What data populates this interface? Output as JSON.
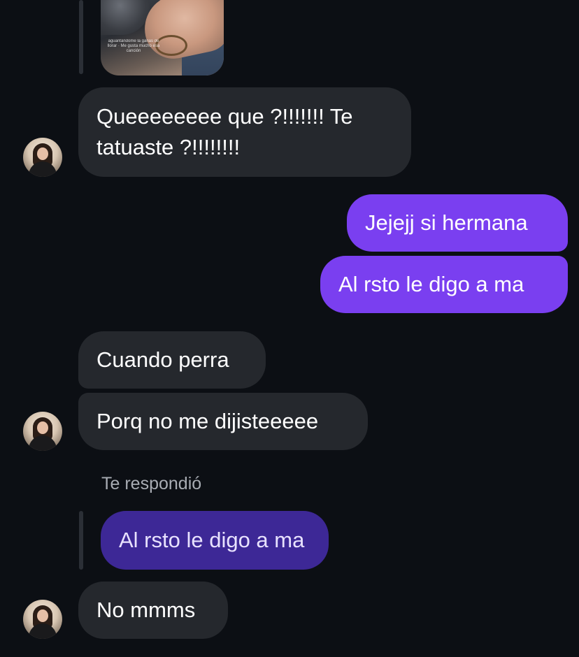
{
  "shared_story": {
    "caption": "aguantándome la ganas de llorar · Me gusta mucho esa canción"
  },
  "messages": [
    {
      "id": "m1",
      "direction": "incoming",
      "text": "Queeeeeeee que ?!!!!!!! Te tatuaste ?!!!!!!!!"
    },
    {
      "id": "m2",
      "direction": "outgoing",
      "text": "Jejejj si hermana"
    },
    {
      "id": "m3",
      "direction": "outgoing",
      "text": "Al rsto le digo a ma"
    },
    {
      "id": "m4",
      "direction": "incoming",
      "text": "Cuando perra"
    },
    {
      "id": "m5",
      "direction": "incoming",
      "text": "Porq no me dijisteeeee"
    },
    {
      "id": "m6",
      "direction": "incoming",
      "reply_label": "Te respondió",
      "quoted_text": "Al rsto le digo a ma"
    },
    {
      "id": "m7",
      "direction": "incoming",
      "text": "No mmms"
    }
  ],
  "colors": {
    "background": "#0c0f14",
    "incoming_bubble": "#25282d",
    "outgoing_bubble": "#7a3ff0",
    "quoted_bubble": "#3d2896",
    "muted_text": "#a8acb3"
  }
}
